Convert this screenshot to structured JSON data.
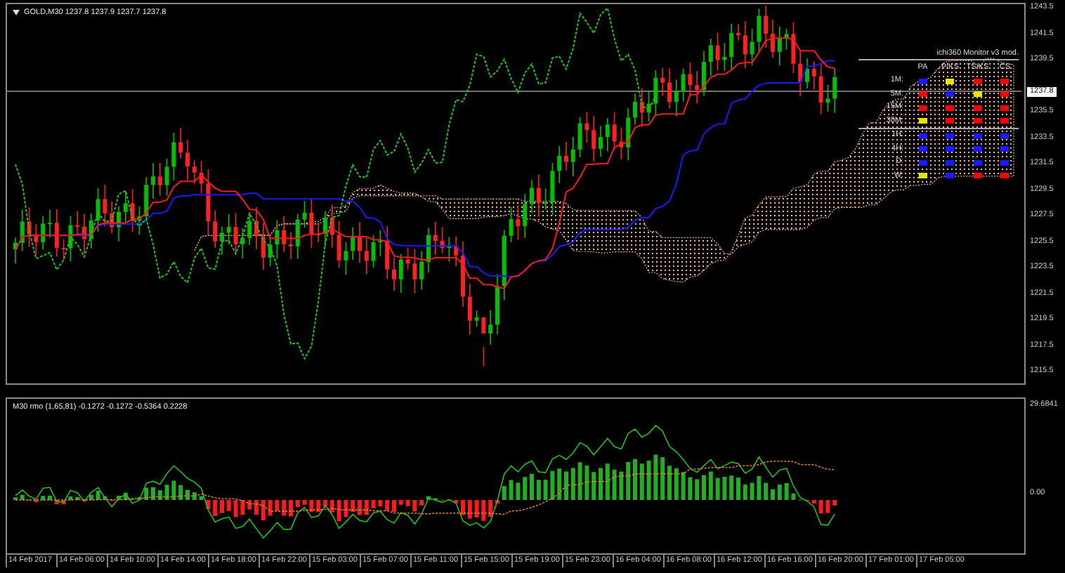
{
  "chart": {
    "title": "GOLD,M30  1237.8 1237.9 1237.7 1237.8"
  },
  "price_axis": {
    "labels": [
      "1243.5",
      "1241.5",
      "1239.5",
      "1235.5",
      "1233.5",
      "1231.5",
      "1229.5",
      "1227.5",
      "1225.5",
      "1223.5",
      "1221.5",
      "1219.5",
      "1217.5",
      "1215.5"
    ],
    "current": "1237.8"
  },
  "monitor": {
    "title": "ichi360 Monitor v3 mod.",
    "columns": [
      "PA",
      "P/KS",
      "TS/KS",
      "CS"
    ],
    "rows": [
      {
        "label": "1M:",
        "cells": [
          {
            "color": "#1a1aff"
          },
          {
            "color": "#e6e600"
          },
          {
            "color": "#ff0000"
          },
          {
            "color": "#ff0000"
          }
        ]
      },
      {
        "label": "5M:",
        "cells": [
          {
            "color": "#ff0000"
          },
          {
            "color": "#1a1aff"
          },
          {
            "color": "#e6e600"
          },
          {
            "color": "#ff0000"
          }
        ]
      },
      {
        "label": "15M:",
        "cells": [
          {
            "color": "#ff0000"
          },
          {
            "color": "#ff0000"
          },
          {
            "color": "#ff0000"
          },
          {
            "color": "#ff0000"
          }
        ]
      },
      {
        "label": "30M:",
        "cells": [
          {
            "color": "#e6e600"
          },
          {
            "color": "#ff0000"
          },
          {
            "color": "#ff0000"
          },
          {
            "color": "#ff0000"
          }
        ]
      },
      {
        "label": "1H:",
        "cells": [
          {
            "color": "#1a1aff"
          },
          {
            "color": "#1a1aff"
          },
          {
            "color": "#1a1aff"
          },
          {
            "color": "#1a1aff"
          }
        ]
      },
      {
        "label": "4H:",
        "cells": [
          {
            "color": "#1a1aff"
          },
          {
            "color": "#1a1aff"
          },
          {
            "color": "#1a1aff"
          },
          {
            "color": "#1a1aff"
          }
        ]
      },
      {
        "label": "D:",
        "cells": [
          {
            "color": "#1a1aff"
          },
          {
            "color": "#1a1aff"
          },
          {
            "color": "#1a1aff"
          },
          {
            "color": "#1a1aff"
          }
        ]
      },
      {
        "label": "W:",
        "cells": [
          {
            "color": "#e6e600"
          },
          {
            "color": "#1a1aff"
          },
          {
            "color": "#ff0000"
          },
          {
            "color": "#ff0000"
          }
        ]
      }
    ]
  },
  "indicator": {
    "title": "M30 rmo (1,65,81) -0.1272 -0.1272 -0.5364 0.2228",
    "axis_labels": [
      "29.6841",
      "0.00"
    ]
  },
  "time_axis": {
    "labels": [
      "14 Feb 2017",
      "14 Feb 06:00",
      "14 Feb 10:00",
      "14 Feb 14:00",
      "14 Feb 18:00",
      "14 Feb 22:00",
      "15 Feb 03:00",
      "15 Feb 07:00",
      "15 Feb 11:00",
      "15 Feb 15:00",
      "15 Feb 19:00",
      "15 Feb 23:00",
      "16 Feb 04:00",
      "16 Feb 08:00",
      "16 Feb 12:00",
      "16 Feb 16:00",
      "16 Feb 20:00",
      "17 Feb 01:00",
      "17 Feb 05:00"
    ]
  }
}
